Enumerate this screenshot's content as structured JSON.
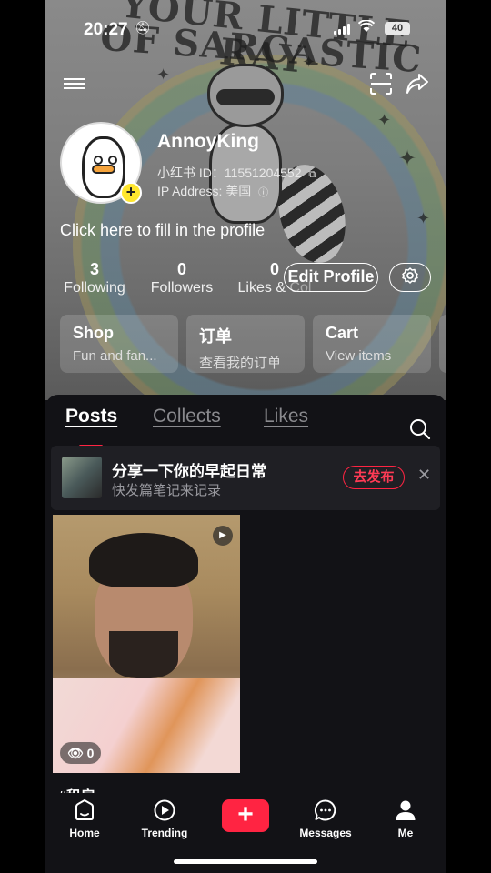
{
  "status": {
    "time": "20:27",
    "battery": "40"
  },
  "background": {
    "line1": "YOUR LITTLE RAY",
    "line2": "OF SARCASTIC"
  },
  "profile": {
    "username": "AnnoyKing",
    "id_label": "小红书 ID：11551204552",
    "ip_label": "IP Address: 美国",
    "fill_prompt": "Click here to fill in the profile",
    "add_badge": "+"
  },
  "stats": {
    "following": {
      "num": "3",
      "label": "Following"
    },
    "followers": {
      "num": "0",
      "label": "Followers"
    },
    "likes": {
      "num": "0",
      "label": "Likes & Col"
    }
  },
  "actions": {
    "edit_profile": "Edit Profile"
  },
  "cards": [
    {
      "title": "Shop",
      "subtitle": "Fun and fan..."
    },
    {
      "title": "订单",
      "subtitle": "查看我的订单"
    },
    {
      "title": "Cart",
      "subtitle": "View items"
    }
  ],
  "tabs": [
    {
      "label": "Posts",
      "active": true
    },
    {
      "label": "Collects",
      "active": false
    },
    {
      "label": "Likes",
      "active": false
    }
  ],
  "promo": {
    "title": "分享一下你的早起日常",
    "subtitle": "快发篇笔记来记录",
    "button": "去发布"
  },
  "post": {
    "views": "0",
    "caption": "#租房"
  },
  "nav": {
    "home": "Home",
    "trending": "Trending",
    "create": "+",
    "messages": "Messages",
    "me": "Me"
  },
  "colors": {
    "accent": "#ff2442",
    "badge": "#ffe62e",
    "sheet": "#121216"
  }
}
